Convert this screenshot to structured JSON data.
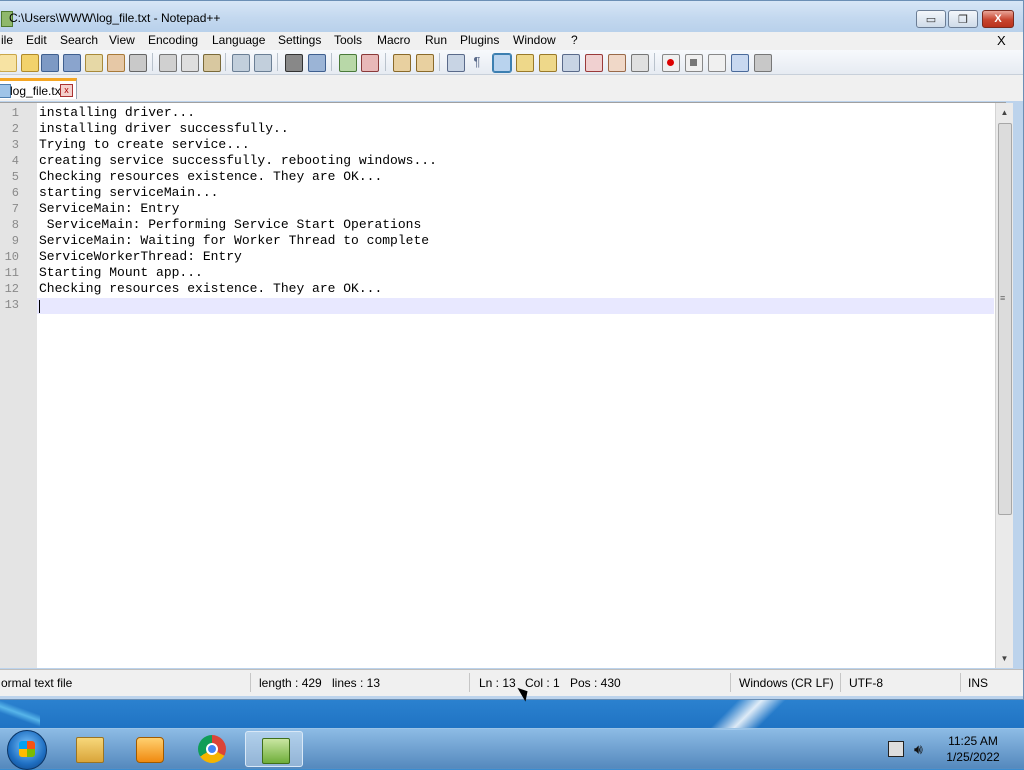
{
  "window": {
    "title": "C:\\Users\\WWW\\log_file.txt - Notepad++",
    "min_symbol": "▭",
    "max_symbol": "❐",
    "close_symbol": "X"
  },
  "menu": {
    "items": [
      "ile",
      "Edit",
      "Search",
      "View",
      "Encoding",
      "Language",
      "Settings",
      "Tools",
      "Macro",
      "Run",
      "Plugins",
      "Window",
      "?"
    ],
    "close_doc": "X"
  },
  "tab": {
    "label": "log_file.txt",
    "close": "x"
  },
  "editor": {
    "lines": [
      "installing driver...",
      "installing driver successfully..",
      "Trying to create service...",
      "creating service successfully. rebooting windows...",
      "Checking resources existence. They are OK...",
      "starting serviceMain...",
      "ServiceMain: Entry",
      " ServiceMain: Performing Service Start Operations",
      "ServiceMain: Waiting for Worker Thread to complete",
      "ServiceWorkerThread: Entry",
      "Starting Mount app...",
      "Checking resources existence. They are OK...",
      ""
    ],
    "line_numbers": [
      "1",
      "2",
      "3",
      "4",
      "5",
      "6",
      "7",
      "8",
      "9",
      "10",
      "11",
      "12",
      "13"
    ]
  },
  "status": {
    "file_type": "ormal text file",
    "length": "length : 429",
    "lines": "lines : 13",
    "ln": "Ln : 13",
    "col": "Col : 1",
    "pos": "Pos : 430",
    "eol": "Windows (CR LF)",
    "encoding": "UTF-8",
    "mode": "INS"
  },
  "taskbar": {
    "clock_time": "11:25 AM",
    "clock_date": "1/25/2022",
    "apps": [
      "explorer-icon",
      "media-player-icon",
      "chrome-icon",
      "notepadpp-icon"
    ]
  },
  "colors": {
    "current_line": "#e8e8ff",
    "tab_accent": "#f5a623",
    "gutter": "#e4e4e4"
  }
}
